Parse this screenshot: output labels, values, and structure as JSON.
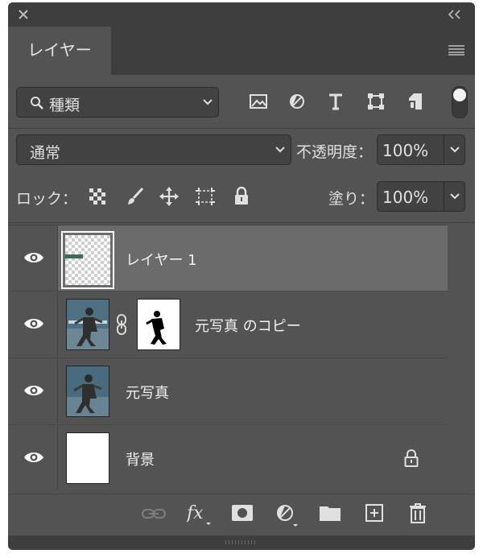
{
  "panel": {
    "tab_label": "レイヤー"
  },
  "filter": {
    "kind_label": "種類"
  },
  "blend": {
    "mode": "通常",
    "opacity_label": "不透明度：",
    "opacity_value": "100%"
  },
  "lock": {
    "label": "ロック：",
    "fill_label": "塗り：",
    "fill_value": "100%"
  },
  "layers": [
    {
      "name": "レイヤー 1"
    },
    {
      "name": "元写真 のコピー"
    },
    {
      "name": "元写真"
    },
    {
      "name": "背景"
    }
  ],
  "colors": {
    "panel_bg": "#535353",
    "selected_row": "#6b6b6b",
    "field_bg": "#424242"
  }
}
